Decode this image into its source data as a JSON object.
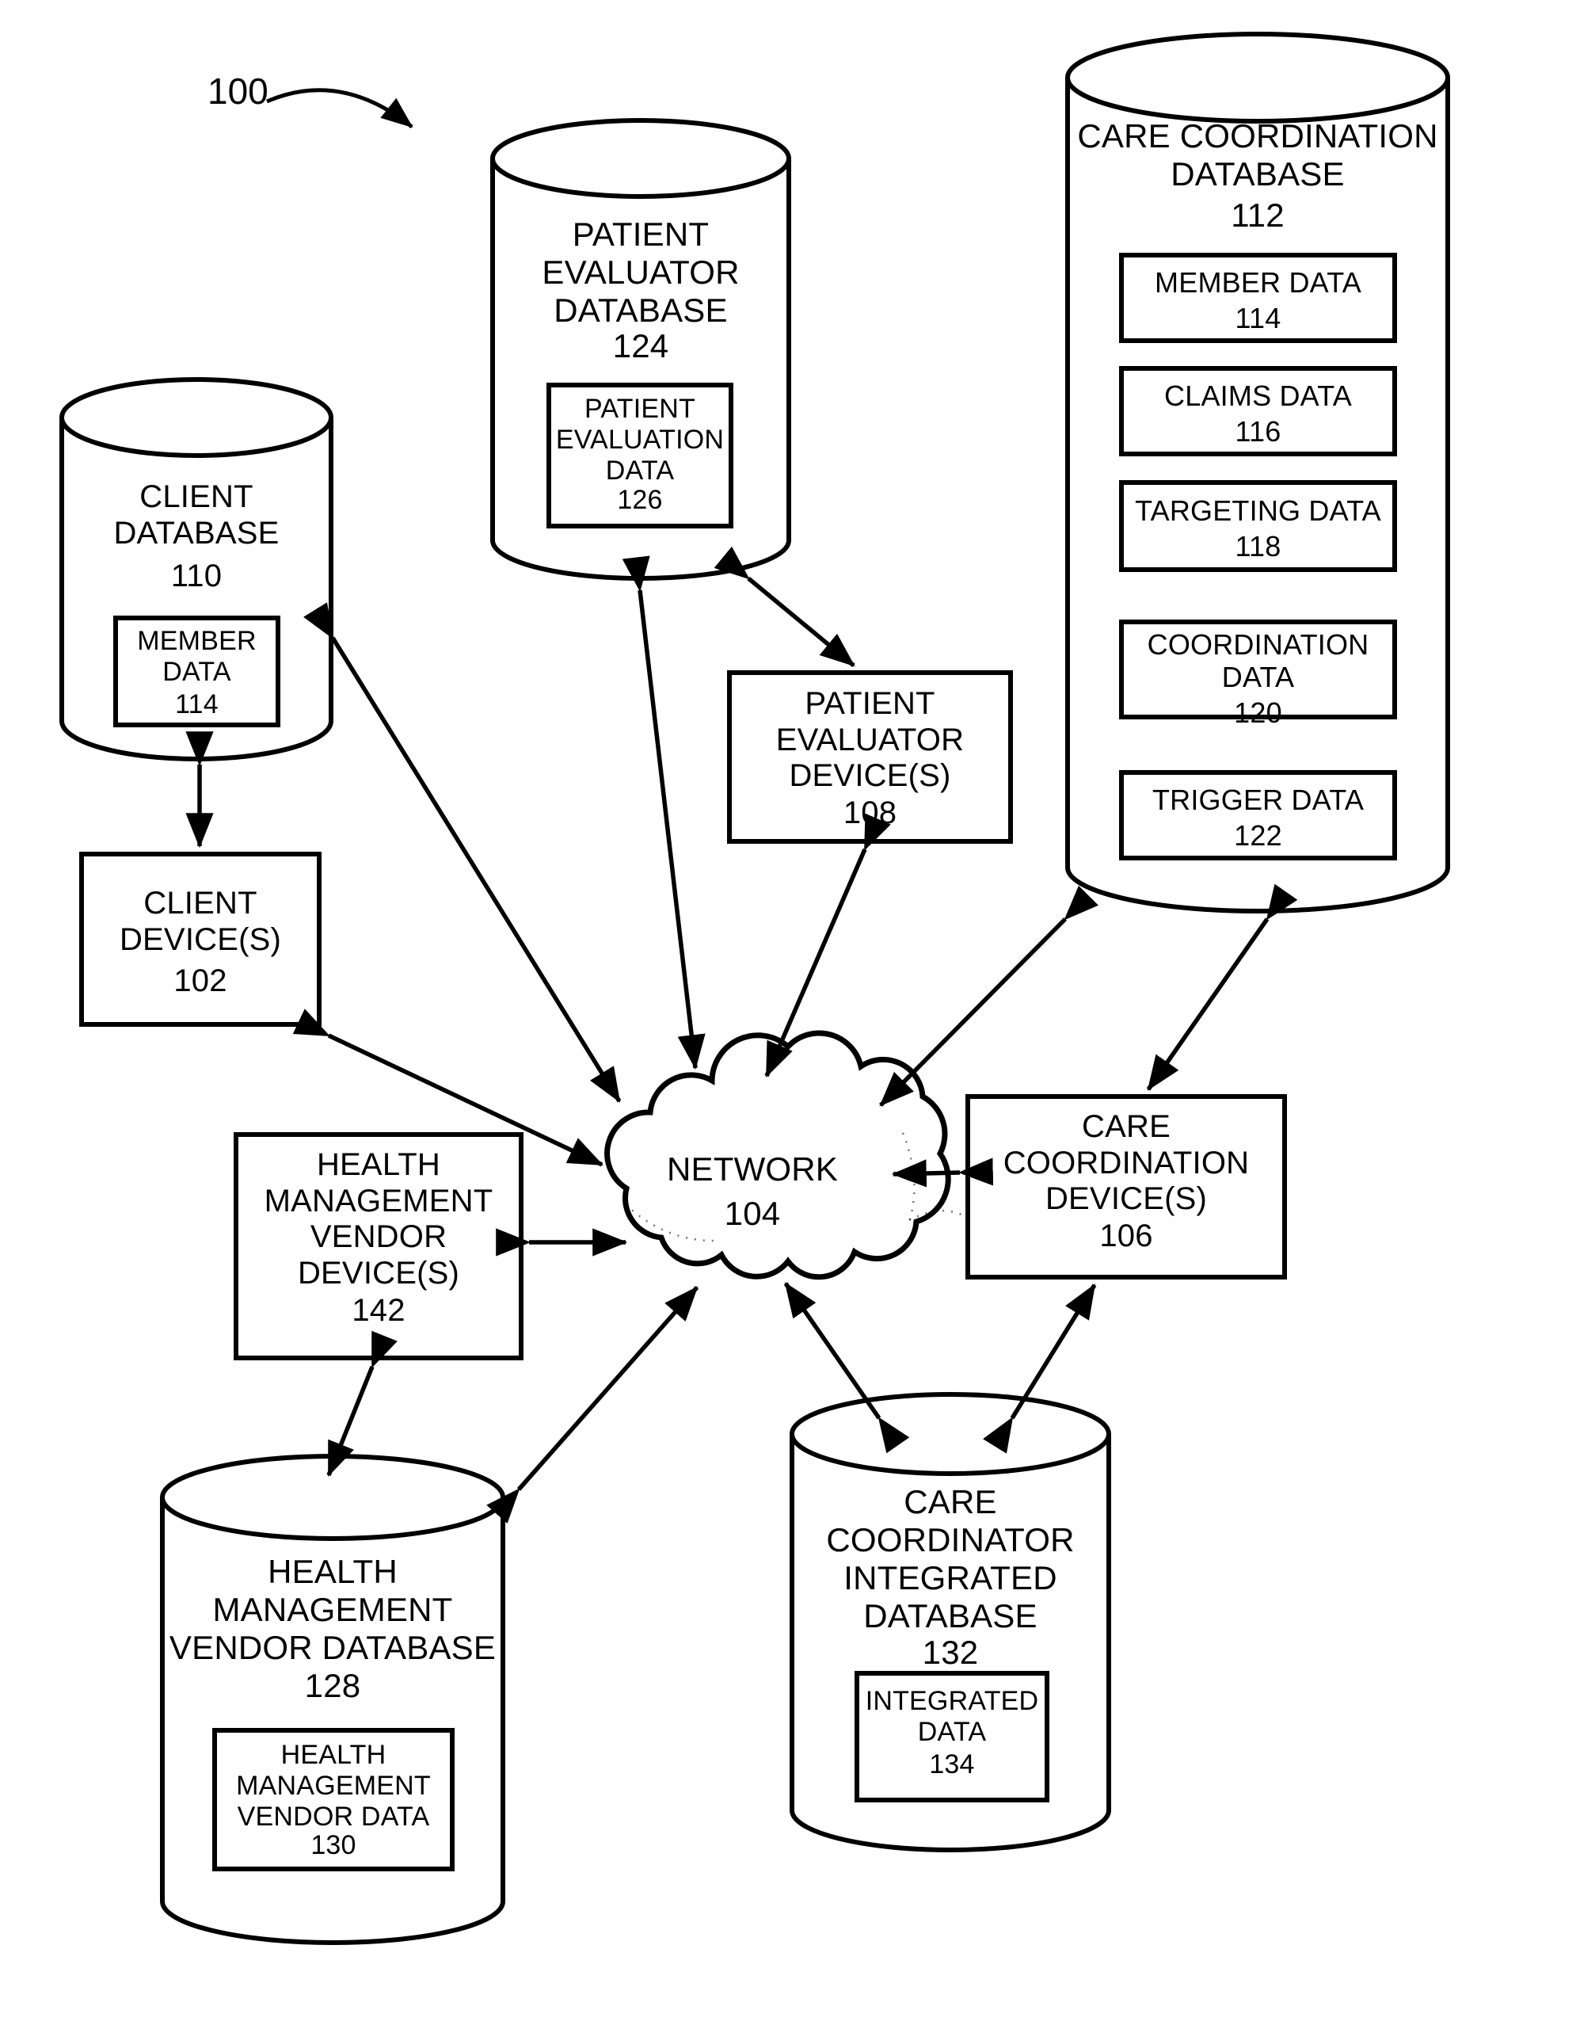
{
  "figure": {
    "label": "100",
    "type": "patent-system-architecture-diagram"
  },
  "nodes": {
    "client_database": {
      "title": "CLIENT\nDATABASE",
      "ref": "110",
      "shape": "cylinder",
      "inner": {
        "title": "MEMBER\nDATA",
        "ref": "114"
      }
    },
    "client_device": {
      "title": "CLIENT\nDEVICE(S)",
      "ref": "102",
      "shape": "rectangle"
    },
    "patient_evaluator_database": {
      "title": "PATIENT\nEVALUATOR\nDATABASE",
      "ref": "124",
      "shape": "cylinder",
      "inner": {
        "title": "PATIENT\nEVALUATION\nDATA",
        "ref": "126"
      }
    },
    "patient_evaluator_device": {
      "title": "PATIENT\nEVALUATOR\nDEVICE(S)",
      "ref": "108",
      "shape": "rectangle"
    },
    "care_coordination_database": {
      "title": "CARE COORDINATION\nDATABASE",
      "ref": "112",
      "shape": "cylinder",
      "inner_boxes": [
        {
          "title": "MEMBER DATA",
          "ref": "114"
        },
        {
          "title": "CLAIMS DATA",
          "ref": "116"
        },
        {
          "title": "TARGETING DATA",
          "ref": "118"
        },
        {
          "title": "COORDINATION\nDATA",
          "ref": "120"
        },
        {
          "title": "TRIGGER DATA",
          "ref": "122"
        }
      ]
    },
    "care_coordination_device": {
      "title": "CARE\nCOORDINATION\nDEVICE(S)",
      "ref": "106",
      "shape": "rectangle"
    },
    "network": {
      "title": "NETWORK",
      "ref": "104",
      "shape": "cloud"
    },
    "health_management_vendor_device": {
      "title": "HEALTH\nMANAGEMENT\nVENDOR\nDEVICE(S)",
      "ref": "142",
      "shape": "rectangle"
    },
    "health_management_vendor_database": {
      "title": "HEALTH\nMANAGEMENT\nVENDOR DATABASE",
      "ref": "128",
      "shape": "cylinder",
      "inner": {
        "title": "HEALTH\nMANAGEMENT\nVENDOR DATA",
        "ref": "130"
      }
    },
    "care_coordinator_integrated_database": {
      "title": "CARE\nCOORDINATOR\nINTEGRATED\nDATABASE",
      "ref": "132",
      "shape": "cylinder",
      "inner": {
        "title": "INTEGRATED\nDATA",
        "ref": "134"
      }
    }
  },
  "connections": [
    {
      "from": "client_database",
      "to": "client_device",
      "arrow": "double"
    },
    {
      "from": "client_database",
      "to": "network",
      "arrow": "double"
    },
    {
      "from": "client_device",
      "to": "network",
      "arrow": "double"
    },
    {
      "from": "patient_evaluator_database",
      "to": "network",
      "arrow": "double"
    },
    {
      "from": "patient_evaluator_database",
      "to": "patient_evaluator_device",
      "arrow": "double"
    },
    {
      "from": "patient_evaluator_device",
      "to": "network",
      "arrow": "double"
    },
    {
      "from": "care_coordination_database",
      "to": "network",
      "arrow": "double"
    },
    {
      "from": "care_coordination_database",
      "to": "care_coordination_device",
      "arrow": "double"
    },
    {
      "from": "care_coordination_device",
      "to": "network",
      "arrow": "double"
    },
    {
      "from": "health_management_vendor_device",
      "to": "network",
      "arrow": "double"
    },
    {
      "from": "health_management_vendor_device",
      "to": "health_management_vendor_database",
      "arrow": "double"
    },
    {
      "from": "health_management_vendor_database",
      "to": "network",
      "arrow": "double"
    },
    {
      "from": "care_coordinator_integrated_database",
      "to": "network",
      "arrow": "double"
    },
    {
      "from": "care_coordinator_integrated_database",
      "to": "care_coordination_device",
      "arrow": "double"
    }
  ],
  "colors": {
    "stroke": "#000000",
    "background": "#ffffff"
  }
}
